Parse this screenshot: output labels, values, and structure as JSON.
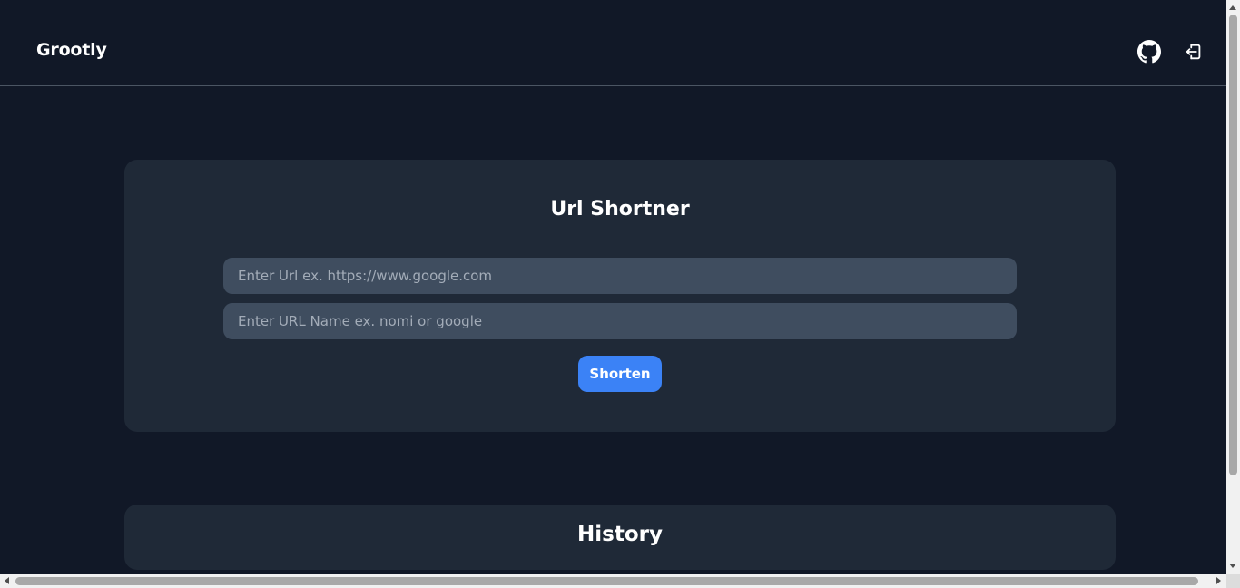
{
  "app": {
    "brand": "Grootly"
  },
  "header": {
    "icons": [
      "github-icon",
      "logout-icon"
    ]
  },
  "shortener": {
    "title": "Url Shortner",
    "url_placeholder": "Enter Url ex. https://www.google.com",
    "url_value": "",
    "name_placeholder": "Enter URL Name ex. nomi or google",
    "name_value": "",
    "button_label": "Shorten"
  },
  "history": {
    "title": "History"
  },
  "colors": {
    "background": "#111827",
    "card": "#1f2937",
    "input": "#3f4d5f",
    "accent": "#3b82f6",
    "divider": "#4b5563"
  }
}
